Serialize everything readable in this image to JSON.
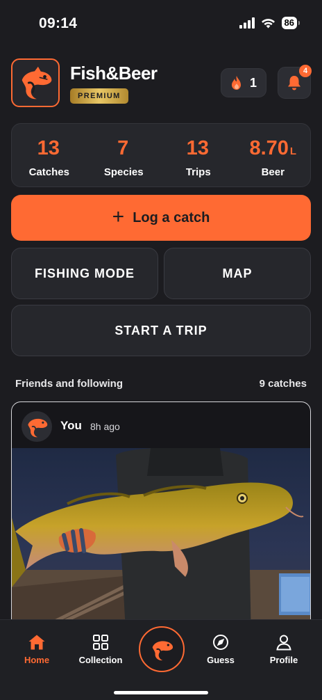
{
  "status_bar": {
    "time": "09:14",
    "battery": "86",
    "icons": [
      "cellular-signal-icon",
      "wifi-icon",
      "battery-icon"
    ]
  },
  "header": {
    "title": "Fish&Beer",
    "badge": "PREMIUM",
    "streak_count": "1",
    "notification_count": "4",
    "icons": [
      "fish-logo-icon",
      "flame-icon",
      "bell-icon"
    ]
  },
  "stats": [
    {
      "value": "13",
      "unit": "",
      "label": "Catches"
    },
    {
      "value": "7",
      "unit": "",
      "label": "Species"
    },
    {
      "value": "13",
      "unit": "",
      "label": "Trips"
    },
    {
      "value": "8.70",
      "unit": "L",
      "label": "Beer"
    }
  ],
  "actions": {
    "log_catch": "Log a catch",
    "fishing_mode": "FISHING MODE",
    "map": "MAP",
    "start_trip": "START A TRIP"
  },
  "feed": {
    "title": "Friends and following",
    "count": "9 catches",
    "posts": [
      {
        "user": "You",
        "time": "8h ago",
        "photo": "person-holding-large-golden-cod-at-night-photo"
      }
    ]
  },
  "tabbar": {
    "tabs": [
      {
        "label": "Home",
        "icon": "home-icon",
        "active": true
      },
      {
        "label": "Collection",
        "icon": "grid-icon",
        "active": false
      },
      {
        "label": "Guess",
        "icon": "compass-icon",
        "active": false
      },
      {
        "label": "Profile",
        "icon": "person-icon",
        "active": false
      }
    ],
    "center_button_icon": "fish-icon"
  },
  "colors": {
    "accent": "#ff6a33",
    "background": "#1c1c20",
    "card": "#26272c",
    "premium_gold": "#d4ac4a"
  }
}
